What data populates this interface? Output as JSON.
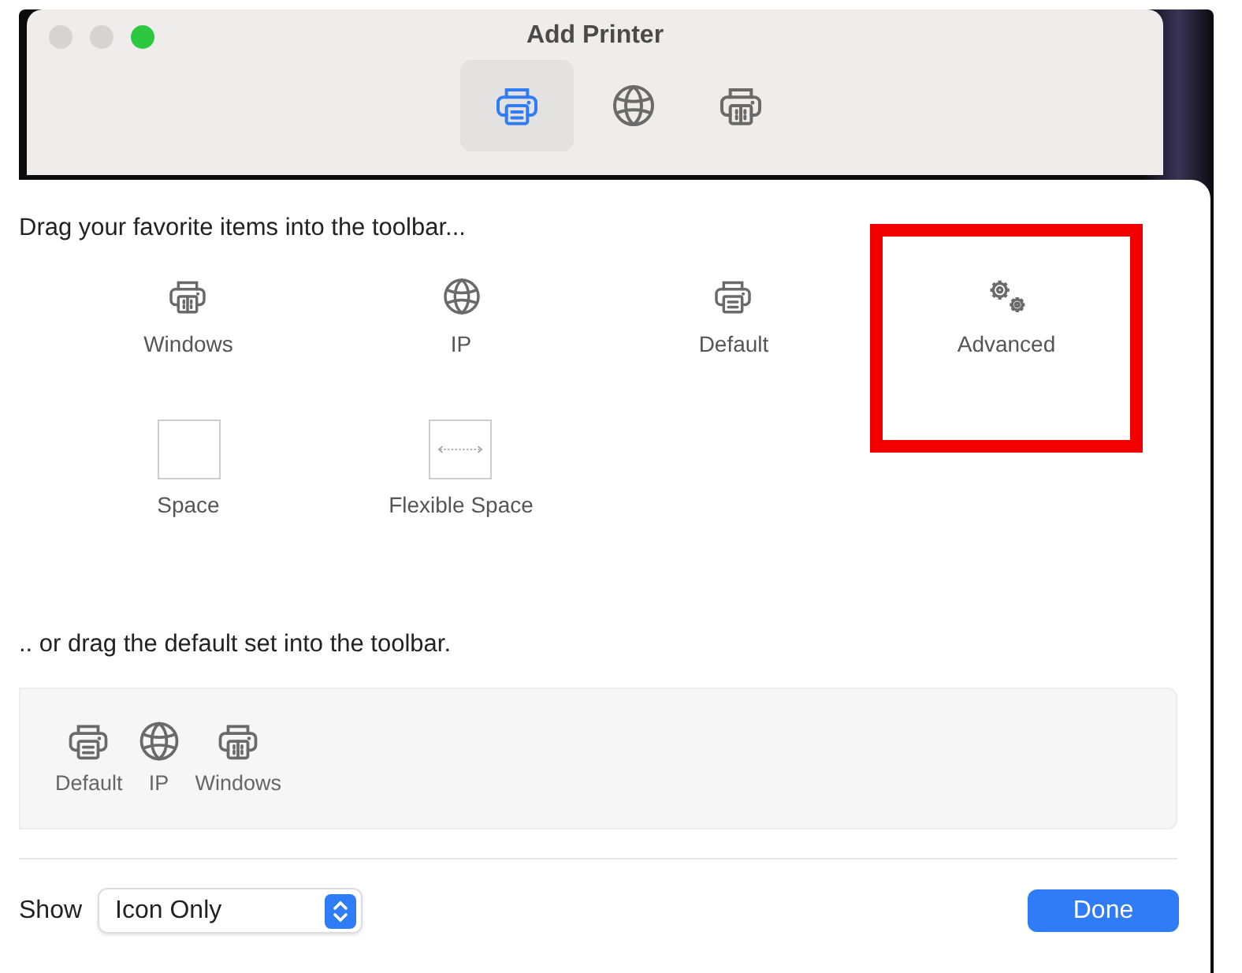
{
  "window": {
    "title": "Add Printer",
    "controls": [
      {
        "color": "#d6d4d2"
      },
      {
        "color": "#d6d4d2"
      },
      {
        "color": "#2cc83f"
      }
    ]
  },
  "toolbar": [
    {
      "kind": "printer",
      "selected": true
    },
    {
      "kind": "globe",
      "selected": false
    },
    {
      "kind": "windows-printer",
      "selected": false
    }
  ],
  "palette": {
    "heading": "Drag your favorite items into the toolbar...",
    "items": [
      {
        "kind": "windows-printer",
        "label": "Windows",
        "highlighted": false
      },
      {
        "kind": "globe",
        "label": "IP",
        "highlighted": false
      },
      {
        "kind": "printer",
        "label": "Default",
        "highlighted": false
      },
      {
        "kind": "gears",
        "label": "Advanced",
        "highlighted": true
      },
      {
        "kind": "space",
        "label": "Space",
        "highlighted": false
      },
      {
        "kind": "flexible-space",
        "label": "Flexible Space",
        "highlighted": false
      }
    ]
  },
  "default_set": {
    "heading": ".. or drag the default set into the toolbar.",
    "items": [
      {
        "kind": "printer",
        "label": "Default"
      },
      {
        "kind": "globe",
        "label": "IP"
      },
      {
        "kind": "windows-printer",
        "label": "Windows"
      }
    ]
  },
  "footer": {
    "show_label": "Show",
    "show_select": {
      "value": "Icon Only"
    },
    "done_button": "Done"
  }
}
